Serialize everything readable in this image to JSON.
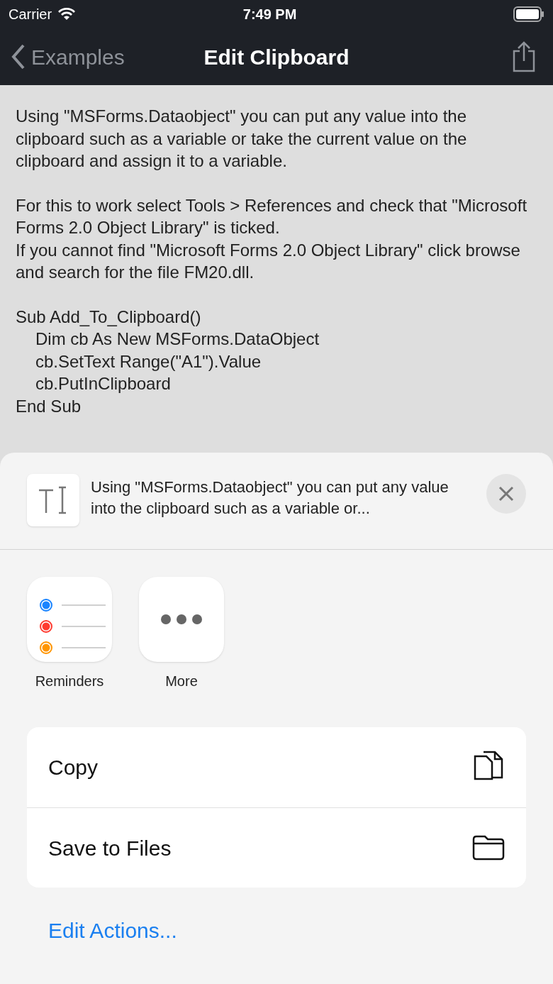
{
  "status_bar": {
    "carrier": "Carrier",
    "time": "7:49 PM"
  },
  "nav": {
    "back": "Examples",
    "title": "Edit Clipboard"
  },
  "content": {
    "paragraphs": [
      "Using \"MSForms.Dataobject\" you can put any value into the clipboard such as a variable or take the current value on the clipboard and assign it to a variable.",
      "For this to work select Tools > References and check that \"Microsoft Forms 2.0 Object Library\" is ticked.\nIf you cannot find \"Microsoft Forms 2.0 Object Library\" click browse and search for the file FM20.dll."
    ],
    "code": [
      {
        "text": "Sub Add_To_Clipboard()",
        "indented": false
      },
      {
        "text": "Dim cb As New MSForms.DataObject",
        "indented": true
      },
      {
        "text": "cb.SetText Range(\"A1\").Value",
        "indented": true
      },
      {
        "text": "cb.PutInClipboard",
        "indented": true
      },
      {
        "text": "End Sub",
        "indented": false
      }
    ]
  },
  "share_sheet": {
    "preview": "Using \"MSForms.Dataobject\" you can put any value into the clipboard such as a variable or...",
    "apps": [
      {
        "label": "Reminders",
        "kind": "reminders"
      },
      {
        "label": "More",
        "kind": "more"
      }
    ],
    "actions": [
      {
        "label": "Copy",
        "kind": "copy"
      },
      {
        "label": "Save to Files",
        "kind": "folder"
      }
    ],
    "edit_actions": "Edit Actions..."
  }
}
